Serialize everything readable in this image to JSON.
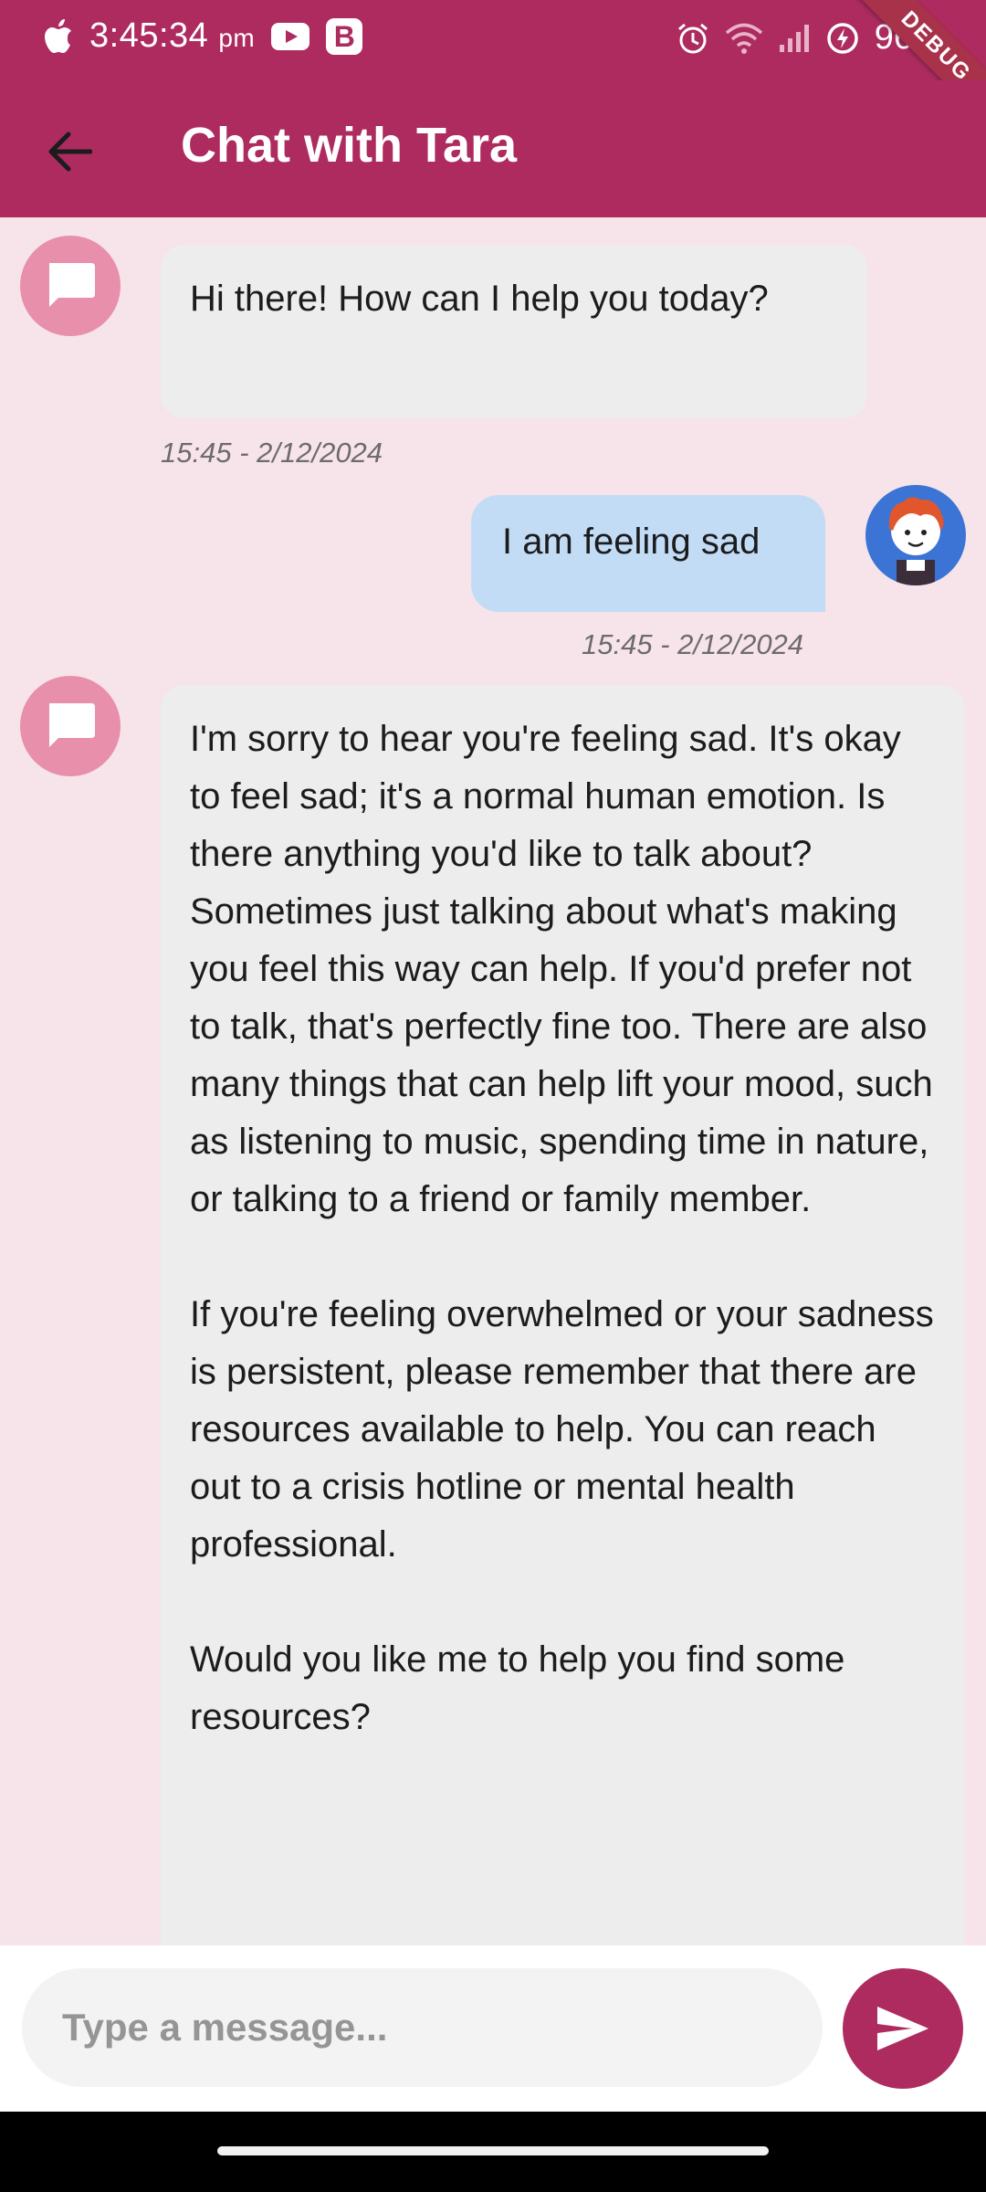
{
  "status_bar": {
    "time": "3:45:34",
    "time_suffix": "pm",
    "battery": "96",
    "icons": [
      "apple-icon",
      "youtube-icon",
      "b-app-icon",
      "alarm-icon",
      "wifi-icon",
      "signal-icon",
      "battery-saver-icon"
    ]
  },
  "debug_banner": "DEBUG",
  "app_bar": {
    "title": "Chat with Tara",
    "back_icon": "arrow-back-icon"
  },
  "messages": [
    {
      "sender": "bot",
      "text": "Hi there! How can I help you today?",
      "timestamp": "15:45 - 2/12/2024"
    },
    {
      "sender": "user",
      "text": "I am feeling sad",
      "timestamp": "15:45 - 2/12/2024"
    },
    {
      "sender": "bot",
      "paragraphs": [
        "I'm sorry to hear you're feeling sad.  It's okay to feel sad; it's a normal human emotion.  Is there anything you'd like to talk about?  Sometimes just talking about what's making you feel this way can help.  If you'd prefer not to talk, that's perfectly fine too.  There are also many things that can help lift your mood, such as listening to music, spending time in nature, or talking to a friend or family member.",
        "If you're feeling overwhelmed or your sadness is persistent, please remember that there are resources available to help. You can reach out to a crisis hotline or mental health professional.",
        "Would you like me to help you find some resources?"
      ]
    }
  ],
  "composer": {
    "placeholder": "Type a message...",
    "send_icon": "send-icon"
  },
  "colors": {
    "primary": "#ad2b5f",
    "background": "#f7e4ea",
    "bot_bubble": "#ededed",
    "user_bubble": "#c3dcf5",
    "bot_avatar": "#e88fab",
    "user_avatar": "#3c74d6"
  }
}
